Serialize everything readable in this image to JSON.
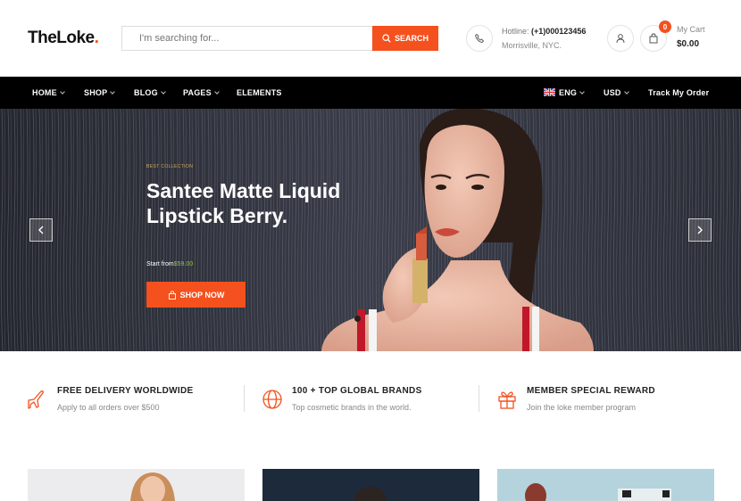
{
  "header": {
    "logo": "TheLoke",
    "logo_dot": ".",
    "search_placeholder": "I'm searching for...",
    "search_button": "SEARCH",
    "hotline_label": "Hotline:",
    "hotline_number": "(+1)000123456",
    "location": "Morrisville, NYC.",
    "cart_count": "0",
    "cart_label": "My Cart",
    "cart_total": "$0.00"
  },
  "nav": {
    "items": [
      "HOME",
      "SHOP",
      "BLOG",
      "PAGES",
      "ELEMENTS"
    ],
    "language": "ENG",
    "currency": "USD",
    "track": "Track My Order"
  },
  "hero": {
    "tag": "BEST COLLECTION",
    "title": "Santee Matte Liquid Lipstick Berry.",
    "price_prefix": "Start from",
    "price": "$59.00",
    "button": "SHOP NOW"
  },
  "features": [
    {
      "title": "FREE DELIVERY WORLDWIDE",
      "subtitle": "Apply to all orders over $500",
      "icon": "airplane-icon"
    },
    {
      "title": "100 + TOP GLOBAL BRANDS",
      "subtitle": "Top cosmetic brands in the world.",
      "icon": "globe-icon"
    },
    {
      "title": "MEMBER SPECIAL REWARD",
      "subtitle": "Join the loke member program",
      "icon": "gift-icon"
    }
  ],
  "colors": {
    "accent": "#f4511e",
    "nav_bg": "#000000",
    "price": "#8bc34a"
  }
}
